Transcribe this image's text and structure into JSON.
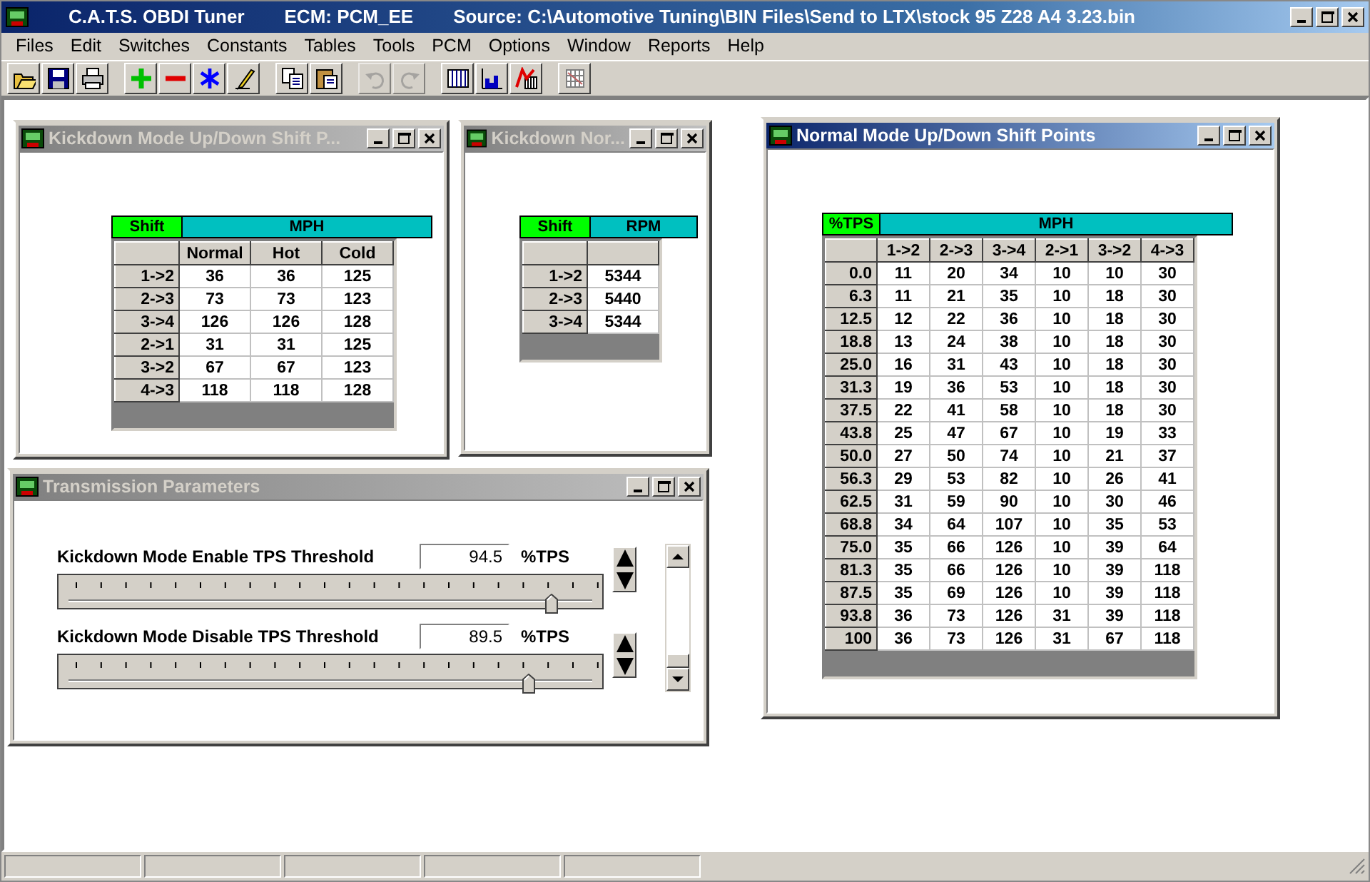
{
  "app": {
    "name": "C.A.T.S. OBDI Tuner",
    "ecm": "ECM: PCM_EE",
    "source": "Source: C:\\Automotive Tuning\\BIN Files\\Send to LTX\\stock 95 Z28 A4 3.23.bin"
  },
  "menu": [
    "Files",
    "Edit",
    "Switches",
    "Constants",
    "Tables",
    "Tools",
    "PCM",
    "Options",
    "Window",
    "Reports",
    "Help"
  ],
  "toolbar": [
    {
      "kind": "open",
      "disabled": false
    },
    {
      "kind": "save",
      "disabled": false
    },
    {
      "kind": "print",
      "disabled": false
    },
    {
      "kind": "sep"
    },
    {
      "kind": "add",
      "disabled": false
    },
    {
      "kind": "subtract",
      "disabled": false
    },
    {
      "kind": "asterisk",
      "disabled": false
    },
    {
      "kind": "pencil",
      "disabled": false
    },
    {
      "kind": "sep"
    },
    {
      "kind": "copy",
      "disabled": false
    },
    {
      "kind": "paste",
      "disabled": false
    },
    {
      "kind": "sep"
    },
    {
      "kind": "undo",
      "disabled": true
    },
    {
      "kind": "redo",
      "disabled": true
    },
    {
      "kind": "sep"
    },
    {
      "kind": "table",
      "disabled": false
    },
    {
      "kind": "chart",
      "disabled": false
    },
    {
      "kind": "chart-edit",
      "disabled": false
    },
    {
      "kind": "sep"
    },
    {
      "kind": "grid",
      "disabled": false
    }
  ],
  "windows": [
    {
      "kind": "table",
      "title": "Kickdown Mode Up/Down Shift P...",
      "active": false,
      "corner": "Shift",
      "band": "MPH",
      "columns": [
        "Normal",
        "Hot",
        "Cold"
      ],
      "rows": [
        {
          "label": "1->2",
          "cells": [
            "36",
            "36",
            "125"
          ]
        },
        {
          "label": "2->3",
          "cells": [
            "73",
            "73",
            "123"
          ]
        },
        {
          "label": "3->4",
          "cells": [
            "126",
            "126",
            "128"
          ]
        },
        {
          "label": "2->1",
          "cells": [
            "31",
            "31",
            "125"
          ]
        },
        {
          "label": "3->2",
          "cells": [
            "67",
            "67",
            "123"
          ]
        },
        {
          "label": "4->3",
          "cells": [
            "118",
            "118",
            "128"
          ]
        }
      ]
    },
    {
      "kind": "params",
      "title": "Transmission Parameters",
      "active": false,
      "params": [
        {
          "label": "Kickdown Mode Enable TPS Threshold",
          "value": "94.5",
          "unit": "%TPS",
          "level": 0.94
        },
        {
          "label": "Kickdown Mode Disable TPS Threshold",
          "value": "89.5",
          "unit": "%TPS",
          "level": 0.895
        }
      ]
    },
    {
      "kind": "table",
      "title": "Kickdown Nor...",
      "active": false,
      "corner": "Shift",
      "band": "RPM",
      "rows": [
        {
          "label": "1->2",
          "cells": [
            "5344"
          ]
        },
        {
          "label": "2->3",
          "cells": [
            "5440"
          ]
        },
        {
          "label": "3->4",
          "cells": [
            "5344"
          ]
        }
      ]
    },
    {
      "kind": "table",
      "title": "Normal Mode Up/Down Shift Points",
      "active": true,
      "corner": "%TPS",
      "band": "MPH",
      "columns": [
        "1->2",
        "2->3",
        "3->4",
        "2->1",
        "3->2",
        "4->3"
      ],
      "rows": [
        {
          "label": "0.0",
          "cells": [
            "11",
            "20",
            "34",
            "10",
            "10",
            "30"
          ]
        },
        {
          "label": "6.3",
          "cells": [
            "11",
            "21",
            "35",
            "10",
            "18",
            "30"
          ]
        },
        {
          "label": "12.5",
          "cells": [
            "12",
            "22",
            "36",
            "10",
            "18",
            "30"
          ]
        },
        {
          "label": "18.8",
          "cells": [
            "13",
            "24",
            "38",
            "10",
            "18",
            "30"
          ]
        },
        {
          "label": "25.0",
          "cells": [
            "16",
            "31",
            "43",
            "10",
            "18",
            "30"
          ]
        },
        {
          "label": "31.3",
          "cells": [
            "19",
            "36",
            "53",
            "10",
            "18",
            "30"
          ]
        },
        {
          "label": "37.5",
          "cells": [
            "22",
            "41",
            "58",
            "10",
            "18",
            "30"
          ]
        },
        {
          "label": "43.8",
          "cells": [
            "25",
            "47",
            "67",
            "10",
            "19",
            "33"
          ]
        },
        {
          "label": "50.0",
          "cells": [
            "27",
            "50",
            "74",
            "10",
            "21",
            "37"
          ]
        },
        {
          "label": "56.3",
          "cells": [
            "29",
            "53",
            "82",
            "10",
            "26",
            "41"
          ]
        },
        {
          "label": "62.5",
          "cells": [
            "31",
            "59",
            "90",
            "10",
            "30",
            "46"
          ]
        },
        {
          "label": "68.8",
          "cells": [
            "34",
            "64",
            "107",
            "10",
            "35",
            "53"
          ]
        },
        {
          "label": "75.0",
          "cells": [
            "35",
            "66",
            "126",
            "10",
            "39",
            "64"
          ]
        },
        {
          "label": "81.3",
          "cells": [
            "35",
            "66",
            "126",
            "10",
            "39",
            "118"
          ]
        },
        {
          "label": "87.5",
          "cells": [
            "35",
            "69",
            "126",
            "10",
            "39",
            "118"
          ]
        },
        {
          "label": "93.8",
          "cells": [
            "36",
            "73",
            "126",
            "31",
            "39",
            "118"
          ]
        },
        {
          "label": "100",
          "cells": [
            "36",
            "73",
            "126",
            "31",
            "67",
            "118"
          ]
        }
      ]
    }
  ]
}
